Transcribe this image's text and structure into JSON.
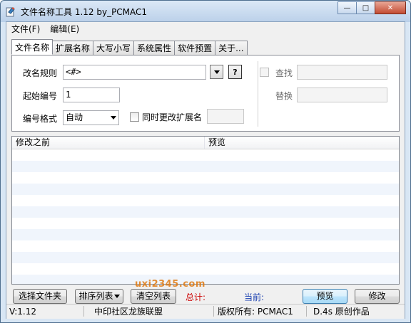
{
  "window": {
    "title": "文件名称工具 1.12  by_PCMAC1",
    "minimize_glyph": "—",
    "maximize_glyph": "□",
    "close_glyph": "✕",
    "app_icon": "rename-tool-icon"
  },
  "menu": [
    "文件(F)",
    "编辑(E)"
  ],
  "tabs": [
    "文件名称",
    "扩展名称",
    "大写小写",
    "系统属性",
    "软件预置",
    "关于..."
  ],
  "form": {
    "rule_label": "改名规则",
    "rule_value": "<#>",
    "help_glyph": "?",
    "start_label": "起始编号",
    "start_value": "1",
    "format_label": "编号格式",
    "format_value": "自动",
    "ext_sync_label": "同时更改扩展名",
    "ext_sync_checked": false,
    "find_label": "查找",
    "find_checked": false,
    "find_value": "",
    "replace_label": "替换",
    "replace_value": ""
  },
  "list": {
    "columns": [
      "修改之前",
      "预览"
    ],
    "rows": []
  },
  "buttons": {
    "select_files": "选择文件夹",
    "sort_list": "排序列表",
    "clear_list": "清空列表",
    "preview": "预览",
    "modify": "修改"
  },
  "stats": {
    "total_label": "总计:",
    "current_label": "当前:",
    "total_color": "#cc0000",
    "current_color": "#1a3fb0"
  },
  "statusbar": {
    "version": "V:1.12",
    "community": "中印社区",
    "league": "龙族联盟",
    "copyright": "版权所有: PCMAC1",
    "original": "D.4s 原创作品"
  },
  "watermark": "uxi2345.com"
}
